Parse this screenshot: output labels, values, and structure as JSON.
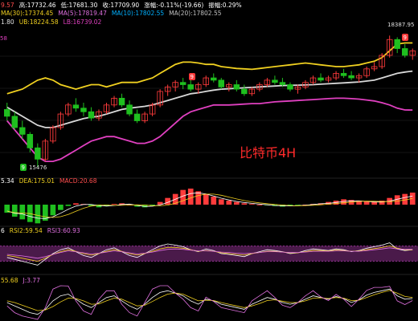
{
  "header": {
    "row1": [
      {
        "text": "9.57",
        "color": "#ff4d4d"
      },
      {
        "text": "高:17732.46",
        "color": "#ffffff"
      },
      {
        "text": "低:17681.30",
        "color": "#ffffff"
      },
      {
        "text": "收:17709.90",
        "color": "#ffffff"
      },
      {
        "text": "涨幅:-0.11%(-19.66)",
        "color": "#ffffff"
      },
      {
        "text": "振幅:0.29%",
        "color": "#ffffff"
      }
    ],
    "row2": [
      {
        "text": "MA(30):17374.45",
        "color": "#f0d020"
      },
      {
        "text": "MA(5):17819.47",
        "color": "#e070e0"
      },
      {
        "text": "MA(10):17802.55",
        "color": "#00b0ff"
      },
      {
        "text": "MA(20):17802.55",
        "color": "#c0c0c0"
      }
    ],
    "row3": [
      {
        "text": "1.80",
        "color": "#e0e0e0"
      },
      {
        "text": "UB:18224.58",
        "color": "#f0d020"
      },
      {
        "text": "LB:16739.02",
        "color": "#e040c0"
      }
    ]
  },
  "watermark": "比特币4H",
  "labels": {
    "price_high_right": "18387.95",
    "left_small": "58",
    "low_marker": "15476",
    "badge_left": "9",
    "badge_mid": "9",
    "badge_right": "9"
  },
  "macd_header": [
    {
      "text": "5.34",
      "color": "#ffffff"
    },
    {
      "text": "DEA:175.01",
      "color": "#f0d020"
    },
    {
      "text": "MACD:20.68",
      "color": "#ff4d4d"
    }
  ],
  "rsi_header": [
    {
      "text": "6",
      "color": "#ffffff"
    },
    {
      "text": "RSI2:59.54",
      "color": "#f0d020"
    },
    {
      "text": "RSI3:60.93",
      "color": "#e070e0"
    }
  ],
  "kdj_header": [
    {
      "text": "55.68",
      "color": "#f0d020"
    },
    {
      "text": "J:3.77",
      "color": "#e070e0"
    }
  ],
  "colors": {
    "up": "#ff3b3b",
    "down": "#1fbf1f",
    "ub": "#f0d020",
    "lb": "#e040c0",
    "ma_white": "#d8d8d8",
    "rsi_band": "#4a1a4a"
  },
  "chart_data": {
    "type": "candlestick",
    "title": "比特币4H",
    "price_range": [
      15300,
      18500
    ],
    "candles_ohlc": [
      [
        16750,
        16900,
        16500,
        16600
      ],
      [
        16600,
        16700,
        16300,
        16350
      ],
      [
        16350,
        16500,
        16100,
        16200
      ],
      [
        16200,
        16250,
        15800,
        15900
      ],
      [
        15900,
        16000,
        15476,
        15650
      ],
      [
        15650,
        16100,
        15600,
        16050
      ],
      [
        16050,
        16400,
        16000,
        16350
      ],
      [
        16350,
        16700,
        16300,
        16650
      ],
      [
        16650,
        16900,
        16600,
        16850
      ],
      [
        16850,
        17000,
        16700,
        16780
      ],
      [
        16780,
        16900,
        16600,
        16700
      ],
      [
        16700,
        16800,
        16500,
        16560
      ],
      [
        16560,
        16750,
        16500,
        16700
      ],
      [
        16700,
        16900,
        16650,
        16850
      ],
      [
        16850,
        17050,
        16800,
        17000
      ],
      [
        17000,
        17100,
        16800,
        16850
      ],
      [
        16850,
        16950,
        16600,
        16650
      ],
      [
        16650,
        16750,
        16450,
        16500
      ],
      [
        16500,
        16700,
        16450,
        16650
      ],
      [
        16650,
        16900,
        16600,
        16850
      ],
      [
        16850,
        17200,
        16800,
        17150
      ],
      [
        17150,
        17300,
        17050,
        17250
      ],
      [
        17250,
        17400,
        17150,
        17350
      ],
      [
        17350,
        17450,
        17200,
        17300
      ],
      [
        17300,
        17400,
        17150,
        17200
      ],
      [
        17200,
        17350,
        17100,
        17300
      ],
      [
        17300,
        17500,
        17250,
        17450
      ],
      [
        17450,
        17550,
        17350,
        17400
      ],
      [
        17400,
        17450,
        17200,
        17250
      ],
      [
        17250,
        17350,
        17150,
        17300
      ],
      [
        17300,
        17400,
        17150,
        17200
      ],
      [
        17200,
        17300,
        17050,
        17100
      ],
      [
        17100,
        17250,
        17050,
        17200
      ],
      [
        17200,
        17350,
        17150,
        17300
      ],
      [
        17300,
        17450,
        17250,
        17400
      ],
      [
        17400,
        17500,
        17300,
        17350
      ],
      [
        17350,
        17450,
        17250,
        17300
      ],
      [
        17300,
        17350,
        17150,
        17200
      ],
      [
        17200,
        17300,
        17100,
        17250
      ],
      [
        17250,
        17400,
        17200,
        17350
      ],
      [
        17350,
        17500,
        17300,
        17450
      ],
      [
        17450,
        17550,
        17350,
        17400
      ],
      [
        17400,
        17500,
        17350,
        17450
      ],
      [
        17450,
        17600,
        17400,
        17550
      ],
      [
        17550,
        17650,
        17450,
        17500
      ],
      [
        17500,
        17600,
        17400,
        17450
      ],
      [
        17450,
        17550,
        17350,
        17500
      ],
      [
        17500,
        17700,
        17450,
        17650
      ],
      [
        17650,
        17800,
        17600,
        17700
      ],
      [
        17700,
        18000,
        17650,
        17950
      ],
      [
        17950,
        18387,
        17900,
        18300
      ],
      [
        18300,
        18350,
        18000,
        18100
      ],
      [
        18100,
        18200,
        17900,
        17950
      ],
      [
        17950,
        18100,
        17850,
        18050
      ]
    ],
    "ma_white": [
      16800,
      16700,
      16600,
      16500,
      16400,
      16350,
      16350,
      16400,
      16450,
      16500,
      16550,
      16580,
      16600,
      16650,
      16700,
      16750,
      16780,
      16800,
      16820,
      16850,
      16900,
      16950,
      17000,
      17050,
      17100,
      17120,
      17150,
      17180,
      17200,
      17210,
      17220,
      17230,
      17240,
      17250,
      17260,
      17270,
      17280,
      17285,
      17290,
      17295,
      17300,
      17310,
      17320,
      17330,
      17340,
      17350,
      17360,
      17380,
      17400,
      17450,
      17500,
      17550,
      17580,
      17600
    ],
    "ub": [
      17100,
      17150,
      17200,
      17300,
      17400,
      17450,
      17400,
      17300,
      17250,
      17200,
      17250,
      17300,
      17300,
      17250,
      17300,
      17350,
      17350,
      17350,
      17400,
      17450,
      17550,
      17650,
      17750,
      17800,
      17800,
      17780,
      17750,
      17750,
      17700,
      17680,
      17660,
      17650,
      17640,
      17660,
      17680,
      17700,
      17720,
      17740,
      17760,
      17780,
      17760,
      17740,
      17720,
      17700,
      17700,
      17720,
      17740,
      17780,
      17820,
      17900,
      18050,
      18200,
      18224,
      18224
    ],
    "lb": [
      16500,
      16300,
      16100,
      15900,
      15700,
      15600,
      15600,
      15650,
      15750,
      15850,
      15950,
      16050,
      16100,
      16150,
      16150,
      16100,
      16050,
      16000,
      16000,
      16050,
      16150,
      16300,
      16450,
      16600,
      16700,
      16750,
      16800,
      16850,
      16850,
      16850,
      16860,
      16870,
      16880,
      16880,
      16900,
      16920,
      16930,
      16940,
      16950,
      16960,
      16970,
      16980,
      16990,
      17000,
      17000,
      16990,
      16980,
      16960,
      16940,
      16900,
      16850,
      16780,
      16740,
      16739
    ],
    "macd_hist": [
      -60,
      -90,
      -110,
      -130,
      -140,
      -120,
      -80,
      -40,
      -10,
      10,
      5,
      -10,
      -20,
      -10,
      5,
      10,
      0,
      -15,
      -20,
      -10,
      20,
      50,
      80,
      110,
      120,
      100,
      80,
      60,
      40,
      30,
      20,
      10,
      5,
      0,
      -5,
      -10,
      -15,
      -10,
      -5,
      0,
      5,
      10,
      20,
      30,
      40,
      35,
      30,
      25,
      20,
      30,
      50,
      70,
      80,
      90
    ],
    "rsi_1": [
      40,
      35,
      30,
      25,
      20,
      35,
      50,
      60,
      65,
      55,
      45,
      40,
      50,
      60,
      65,
      55,
      45,
      40,
      50,
      60,
      70,
      75,
      72,
      68,
      60,
      55,
      62,
      58,
      50,
      48,
      45,
      42,
      50,
      55,
      60,
      58,
      55,
      50,
      52,
      58,
      62,
      60,
      58,
      62,
      60,
      55,
      58,
      64,
      68,
      72,
      78,
      62,
      58,
      60
    ],
    "rsi_2": [
      45,
      42,
      38,
      34,
      30,
      38,
      48,
      55,
      60,
      56,
      50,
      46,
      50,
      56,
      60,
      56,
      50,
      46,
      50,
      56,
      62,
      66,
      66,
      64,
      60,
      56,
      58,
      56,
      52,
      50,
      48,
      46,
      50,
      53,
      56,
      56,
      54,
      52,
      52,
      55,
      58,
      58,
      57,
      59,
      58,
      56,
      57,
      60,
      63,
      66,
      70,
      64,
      60,
      60
    ],
    "rsi_3": [
      48,
      46,
      44,
      41,
      38,
      42,
      48,
      53,
      57,
      55,
      52,
      49,
      51,
      54,
      57,
      55,
      52,
      49,
      51,
      54,
      58,
      61,
      62,
      61,
      59,
      57,
      57,
      56,
      54,
      53,
      51,
      50,
      51,
      53,
      55,
      55,
      54,
      53,
      53,
      54,
      56,
      56,
      56,
      57,
      57,
      56,
      56,
      58,
      60,
      62,
      65,
      62,
      61,
      61
    ],
    "kdj_k": [
      50,
      40,
      30,
      20,
      15,
      30,
      55,
      70,
      75,
      60,
      45,
      35,
      50,
      65,
      70,
      55,
      40,
      30,
      45,
      65,
      80,
      85,
      78,
      70,
      55,
      45,
      60,
      55,
      45,
      40,
      35,
      30,
      45,
      55,
      65,
      60,
      50,
      45,
      50,
      60,
      70,
      65,
      60,
      68,
      62,
      50,
      58,
      72,
      80,
      85,
      90,
      70,
      60,
      62
    ],
    "kdj_d": [
      55,
      50,
      42,
      34,
      26,
      28,
      38,
      52,
      63,
      62,
      55,
      45,
      46,
      55,
      63,
      60,
      50,
      40,
      42,
      53,
      65,
      75,
      78,
      75,
      65,
      55,
      57,
      56,
      50,
      45,
      40,
      35,
      40,
      47,
      56,
      58,
      54,
      50,
      50,
      55,
      63,
      64,
      62,
      65,
      63,
      56,
      57,
      65,
      73,
      80,
      86,
      78,
      68,
      65
    ],
    "kdj_j": [
      40,
      20,
      10,
      5,
      0,
      35,
      90,
      100,
      99,
      55,
      25,
      15,
      60,
      85,
      85,
      45,
      20,
      10,
      50,
      90,
      100,
      100,
      78,
      60,
      35,
      25,
      66,
      53,
      35,
      30,
      25,
      20,
      55,
      70,
      85,
      65,
      42,
      35,
      50,
      70,
      85,
      67,
      56,
      74,
      60,
      38,
      60,
      86,
      95,
      95,
      98,
      55,
      44,
      56
    ]
  }
}
